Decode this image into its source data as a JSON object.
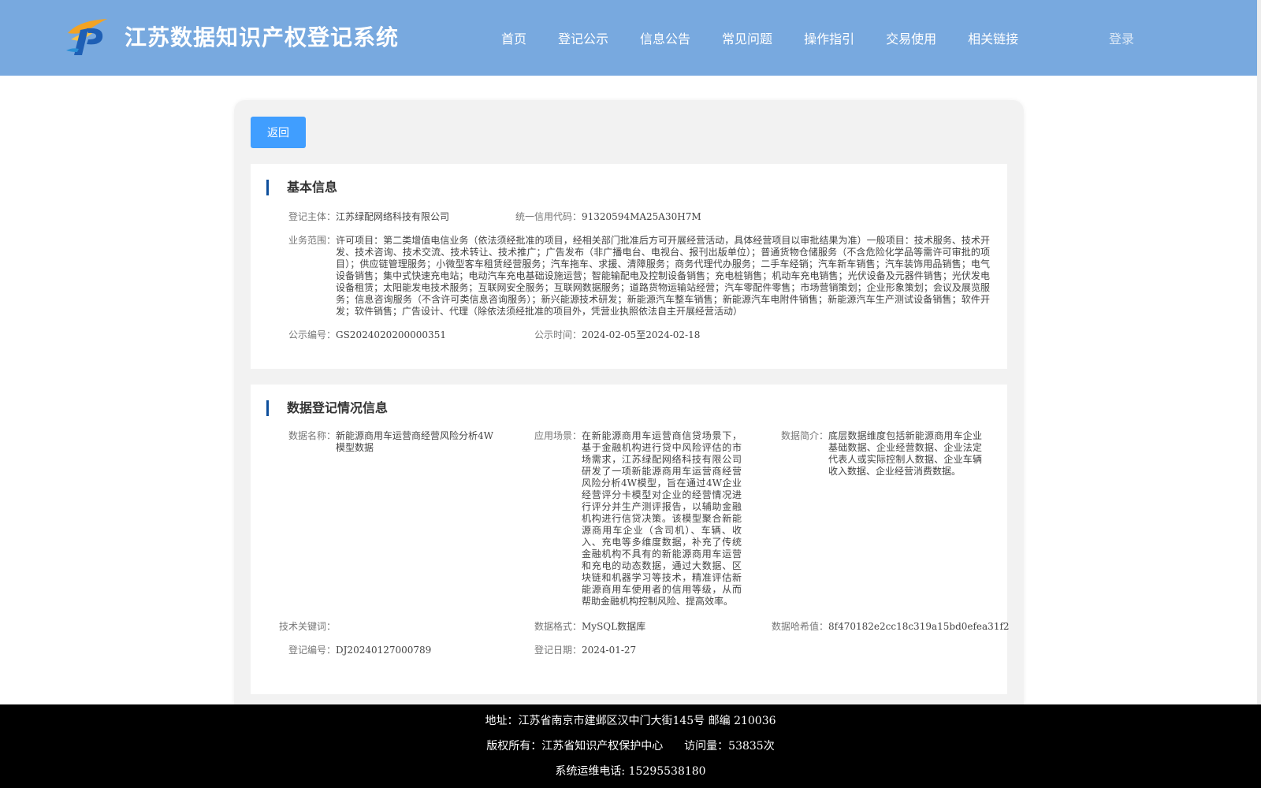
{
  "header": {
    "title": "江苏数据知识产权登记系统",
    "nav": [
      "首页",
      "登记公示",
      "信息公告",
      "常见问题",
      "操作指引",
      "交易使用",
      "相关链接"
    ],
    "login": "登录",
    "logo_icon": "ip-logo-icon"
  },
  "actions": {
    "back_label": "返回"
  },
  "basic": {
    "title": "基本信息",
    "subject_label": "登记主体：",
    "subject": "江苏绿配网络科技有限公司",
    "credit_label": "统一信用代码：",
    "credit": "91320594MA25A30H7M",
    "scope_label": "业务范围：",
    "scope": "许可项目：第二类增值电信业务（依法须经批准的项目，经相关部门批准后方可开展经营活动，具体经营项目以审批结果为准）一般项目：技术服务、技术开发、技术咨询、技术交流、技术转让、技术推广；广告发布（非广播电台、电视台、报刊出版单位）；普通货物仓储服务（不含危险化学品等需许可审批的项目）；供应链管理服务；小微型客车租赁经营服务；汽车拖车、求援、清障服务；商务代理代办服务；二手车经销；汽车新车销售；汽车装饰用品销售；电气设备销售；集中式快速充电站；电动汽车充电基础设施运营；智能输配电及控制设备销售；充电桩销售；机动车充电销售；光伏设备及元器件销售；光伏发电设备租赁；太阳能发电技术服务；互联网安全服务；互联网数据服务；道路货物运输站经营；汽车零配件零售；市场营销策划；企业形象策划；会议及展览服务；信息咨询服务（不含许可类信息咨询服务）；新兴能源技术研发；新能源汽车整车销售；新能源汽车电附件销售；新能源汽车生产测试设备销售；软件开发；软件销售；广告设计、代理（除依法须经批准的项目外，凭营业执照依法自主开展经营活动）",
    "notice_no_label": "公示编号：",
    "notice_no": "GS2024020200000351",
    "notice_time_label": "公示时间：",
    "notice_time": "2024-02-05至2024-02-18"
  },
  "data_reg": {
    "title": "数据登记情况信息",
    "name_label": "数据名称：",
    "name": "新能源商用车运营商经营风险分析4W模型数据",
    "scene_label": "应用场景：",
    "scene": "在新能源商用车运营商信贷场景下，基于金融机构进行贷中风险评估的市场需求，江苏绿配网络科技有限公司研发了一项新能源商用车运营商经营风险分析4W模型，旨在通过4W企业经营评分卡模型对企业的经营情况进行评分并生产测评报告，以辅助金融机构进行信贷决策。该模型聚合新能源商用车企业（含司机）、车辆、收入、充电等多维度数据，补充了传统金融机构不具有的新能源商用车运营和充电的动态数据，通过大数据、区块链和机器学习等技术，精准评估新能源商用车使用者的信用等级，从而帮助金融机构控制风险、提高效率。",
    "intro_label": "数据简介：",
    "intro": "底层数据维度包括新能源商用车企业基础数据、企业经营数据、企业法定代表人或实际控制人数据、企业车辆收入数据、企业经营消费数据。",
    "keywords_label": "技术关键词：",
    "keywords": "",
    "format_label": "数据格式：",
    "format": "MySQL数据库",
    "hash_label": "数据哈希值：",
    "hash": "8f470182e2cc18c319a15bd0efea31f2",
    "reg_no_label": "登记编号：",
    "reg_no": "DJ20240127000789",
    "reg_date_label": "登记日期：",
    "reg_date": "2024-01-27"
  },
  "footer": {
    "address": "地址：江苏省南京市建邺区汉中门大街145号 邮编 210036",
    "copyright": "版权所有：江苏省知识产权保护中心",
    "visits_label": "访问量：",
    "visits": "53835次",
    "phone_label": "系统运维电话:",
    "phone": "15295538180"
  },
  "colors": {
    "header_bg": "#78a9df",
    "accent_button": "#409eff",
    "section_bar": "#0e4f9c",
    "footer_bg": "#000000"
  }
}
